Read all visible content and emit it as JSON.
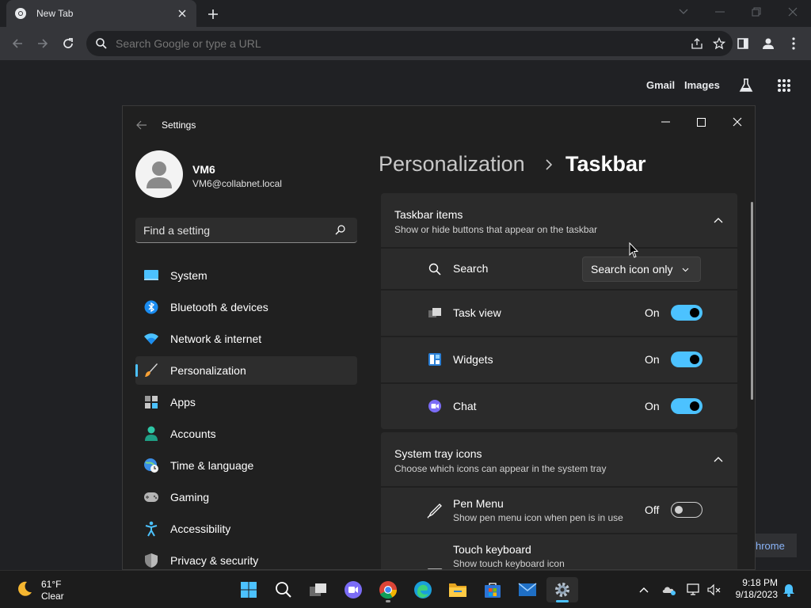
{
  "browser": {
    "tab_title": "New Tab",
    "omnibox_placeholder": "Search Google or type a URL",
    "ntp_links": {
      "gmail": "Gmail",
      "images": "Images"
    },
    "bottom_pill": "hrome"
  },
  "settings": {
    "window_title": "Settings",
    "profile": {
      "name": "VM6",
      "email": "VM6@collabnet.local"
    },
    "search_placeholder": "Find a setting",
    "nav": [
      {
        "label": "System",
        "icon": "monitor-icon"
      },
      {
        "label": "Bluetooth & devices",
        "icon": "bluetooth-icon"
      },
      {
        "label": "Network & internet",
        "icon": "wifi-icon"
      },
      {
        "label": "Personalization",
        "icon": "brush-icon",
        "active": true
      },
      {
        "label": "Apps",
        "icon": "apps-icon"
      },
      {
        "label": "Accounts",
        "icon": "person-icon"
      },
      {
        "label": "Time & language",
        "icon": "clock-globe-icon"
      },
      {
        "label": "Gaming",
        "icon": "gamepad-icon"
      },
      {
        "label": "Accessibility",
        "icon": "accessibility-icon"
      },
      {
        "label": "Privacy & security",
        "icon": "shield-icon"
      }
    ],
    "breadcrumb": {
      "parent": "Personalization",
      "current": "Taskbar"
    },
    "groups": {
      "taskbar_items": {
        "title": "Taskbar items",
        "subtitle": "Show or hide buttons that appear on the taskbar",
        "rows": {
          "search": {
            "label": "Search",
            "dropdown_value": "Search icon only"
          },
          "task_view": {
            "label": "Task view",
            "state": "On",
            "enabled": true
          },
          "widgets": {
            "label": "Widgets",
            "state": "On",
            "enabled": true
          },
          "chat": {
            "label": "Chat",
            "state": "On",
            "enabled": true
          }
        }
      },
      "system_tray": {
        "title": "System tray icons",
        "subtitle": "Choose which icons can appear in the system tray",
        "rows": {
          "pen_menu": {
            "label": "Pen Menu",
            "subtitle": "Show pen menu icon when pen is in use",
            "state": "Off",
            "enabled": false
          },
          "touch_keyboard": {
            "label": "Touch keyboard",
            "subtitle": "Show touch keyboard icon"
          }
        }
      }
    }
  },
  "taskbar": {
    "weather": {
      "temp": "61°F",
      "condition": "Clear"
    },
    "clock": {
      "time": "9:18 PM",
      "date": "9/18/2023"
    }
  },
  "colors": {
    "accent": "#4cc2ff",
    "settings_bg": "#202020",
    "card_bg": "#2b2b2b",
    "chrome_toolbar": "#35363a"
  }
}
